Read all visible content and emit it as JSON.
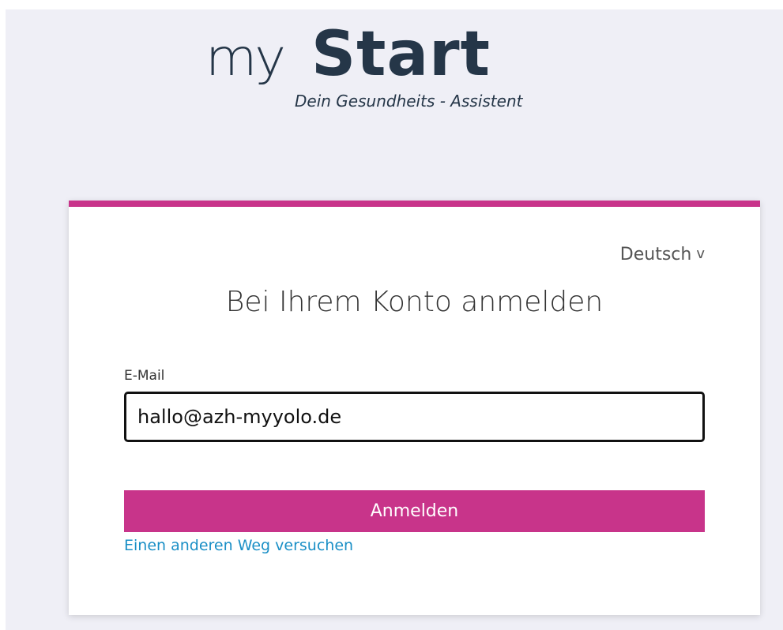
{
  "logo": {
    "my": "my",
    "start": "Start",
    "tagline": "Dein Gesundheits - Assistent"
  },
  "card": {
    "accent_color": "#c8348a",
    "language": "Deutsch",
    "language_icon": "chevron-down-icon",
    "title": "Bei Ihrem Konto anmelden",
    "email_label": "E-Mail",
    "email_value": "hallo@azh-myyolo.de",
    "submit_label": "Anmelden",
    "alt_link": "Einen anderen Weg versuchen"
  }
}
